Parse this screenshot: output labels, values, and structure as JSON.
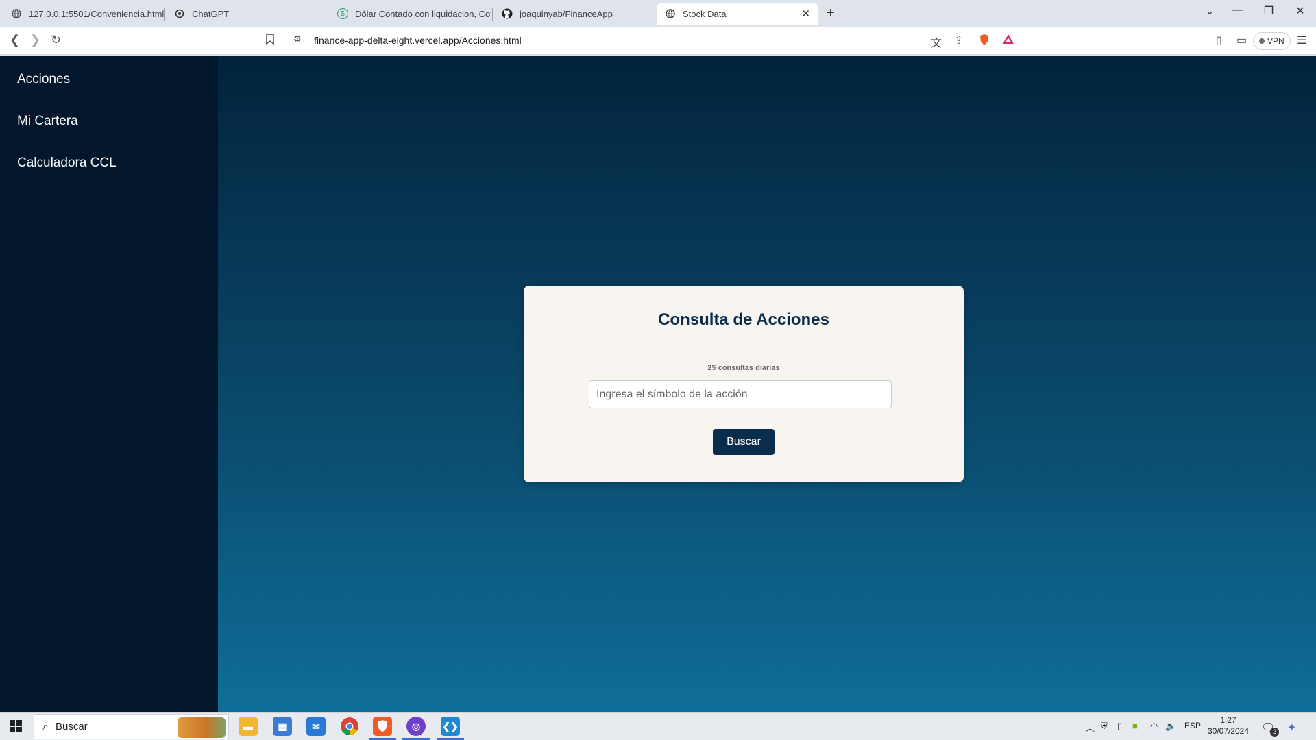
{
  "browser": {
    "tabs": [
      {
        "title": "127.0.0.1:5501/Conveniencia.html",
        "icon": "globe-icon"
      },
      {
        "title": "ChatGPT",
        "icon": "chatgpt-icon"
      },
      {
        "title": "Dólar Contado con liquidacion, Cot",
        "icon": "dollar-icon"
      },
      {
        "title": "joaquinyab/FinanceApp",
        "icon": "github-icon"
      },
      {
        "title": "Stock Data",
        "icon": "globe-icon"
      }
    ],
    "new_tab": "+",
    "url": "finance-app-delta-eight.vercel.app/Acciones.html",
    "vpn_label": "VPN"
  },
  "sidebar": {
    "items": [
      {
        "label": "Acciones"
      },
      {
        "label": "Mi Cartera"
      },
      {
        "label": "Calculadora CCL"
      }
    ]
  },
  "card": {
    "title": "Consulta de Acciones",
    "quota_text": "25 consultas diarias",
    "input_placeholder": "Ingresa el símbolo de la acción",
    "input_value": "",
    "button_label": "Buscar"
  },
  "taskbar": {
    "search_label": "Buscar",
    "apps": [
      "file-explorer-icon",
      "store-icon",
      "mail-icon",
      "chrome-icon",
      "brave-icon",
      "github-desktop-icon",
      "vscode-icon"
    ],
    "language": "ESP",
    "time": "1:27",
    "date": "30/07/2024",
    "notification_count": "2"
  },
  "colors": {
    "sidebar_bg": "#02172b",
    "main_gradient_top": "#02233c",
    "main_gradient_bottom": "#0f6e99",
    "card_bg": "#f8f5f0",
    "accent": "#0b2d4d"
  }
}
